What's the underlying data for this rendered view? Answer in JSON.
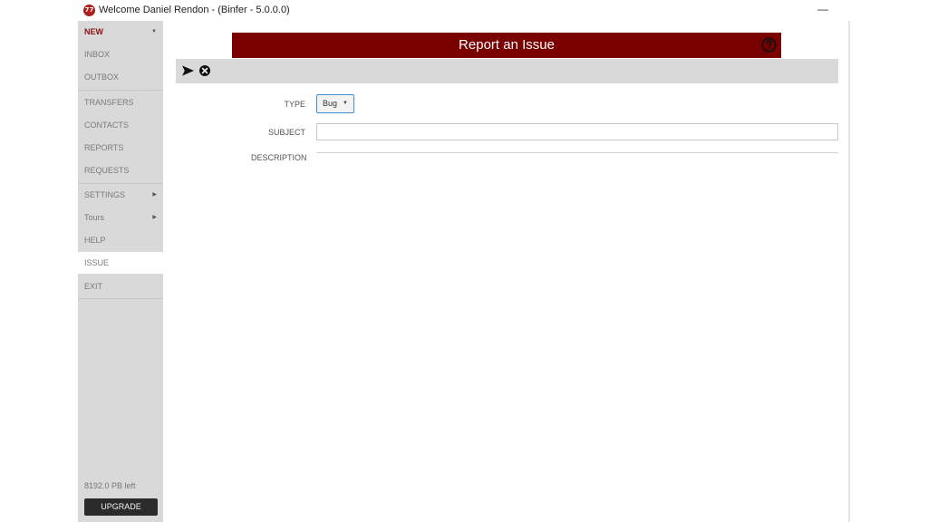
{
  "window": {
    "title": "Welcome Daniel Rendon - (Binfer - 5.0.0.0)",
    "logo_text": "77",
    "minimize_symbol": "—"
  },
  "sidebar": {
    "items": [
      {
        "label": "NEW",
        "arrow": "▼"
      },
      {
        "label": "INBOX"
      },
      {
        "label": "OUTBOX"
      },
      {
        "label": "TRANSFERS"
      },
      {
        "label": "CONTACTS"
      },
      {
        "label": "REPORTS"
      },
      {
        "label": "REQUESTS"
      },
      {
        "label": "SETTINGS",
        "arrow": "▶"
      },
      {
        "label": "Tours",
        "arrow": "▶"
      },
      {
        "label": "HELP"
      },
      {
        "label": "ISSUE"
      },
      {
        "label": "EXIT"
      }
    ],
    "storage_left": "8192.0 PB left",
    "upgrade_label": "UPGRADE"
  },
  "header": {
    "title": "Report an Issue"
  },
  "form": {
    "type_label": "TYPE",
    "type_value": "Bug",
    "type_caret": "▼",
    "subject_label": "SUBJECT",
    "subject_value": "",
    "description_label": "DESCRIPTION",
    "description_value": ""
  },
  "colors": {
    "header_bg": "#7a0000",
    "new_item": "#8b1111",
    "sidebar_bg": "#d9d9d9",
    "toolbar_bg": "#d9d9d9",
    "select_border": "#3f8fd2"
  },
  "icons": {
    "send": "send-icon",
    "cancel": "cancel-icon",
    "help": "help-icon"
  }
}
